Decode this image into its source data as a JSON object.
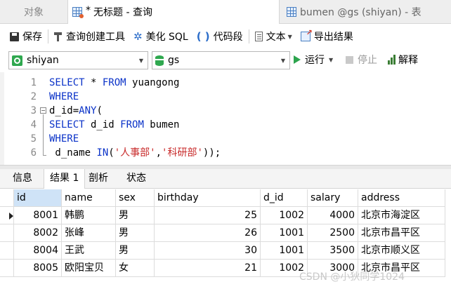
{
  "tabs": {
    "objects": "对象",
    "query": {
      "modified": "*",
      "label": "无标题 - 查询"
    },
    "table": "bumen @gs (shiyan) - 表"
  },
  "toolbar": {
    "save": "保存",
    "query_builder": "查询创建工具",
    "beautify": "美化 SQL",
    "snippet": "代码段",
    "text": "文本",
    "export": "导出结果"
  },
  "connection": {
    "conn_name": "shiyan",
    "db_name": "gs",
    "run": "运行",
    "stop": "停止",
    "explain": "解释"
  },
  "editor": {
    "line_numbers": [
      "1",
      "2",
      "3",
      "4",
      "5",
      "6"
    ]
  },
  "result_tabs": [
    "信息",
    "结果 1",
    "剖析",
    "状态"
  ],
  "grid": {
    "columns": [
      "id",
      "name",
      "sex",
      "birthday",
      "d_id",
      "salary",
      "address"
    ],
    "rows": [
      [
        "8001",
        "韩鹏",
        "男",
        "25",
        "1002",
        "4000",
        "北京市海淀区"
      ],
      [
        "8002",
        "张峰",
        "男",
        "26",
        "1001",
        "2500",
        "北京市昌平区"
      ],
      [
        "8004",
        "王武",
        "男",
        "30",
        "1001",
        "3500",
        "北京市顺义区"
      ],
      [
        "8005",
        "欧阳宝贝",
        "女",
        "21",
        "1002",
        "3000",
        "北京市昌平区"
      ]
    ]
  },
  "watermark": "CSDN @小狄同学1024",
  "colors": {
    "keyword": "#0a32c8",
    "string": "#c82a2a",
    "run_icon": "#2da44e"
  }
}
